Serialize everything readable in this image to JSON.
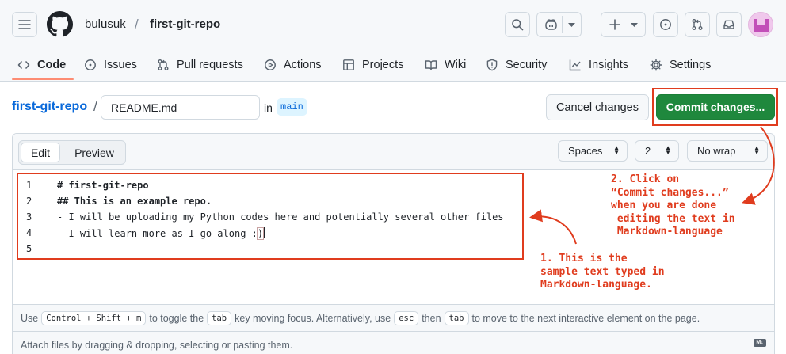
{
  "header": {
    "owner": "bulusuk",
    "separator": "/",
    "repo": "first-git-repo"
  },
  "tabs": [
    {
      "label": "Code",
      "icon": "code-icon",
      "active": true
    },
    {
      "label": "Issues",
      "icon": "issue-opened-icon"
    },
    {
      "label": "Pull requests",
      "icon": "git-pull-request-icon"
    },
    {
      "label": "Actions",
      "icon": "play-icon"
    },
    {
      "label": "Projects",
      "icon": "table-icon"
    },
    {
      "label": "Wiki",
      "icon": "book-icon"
    },
    {
      "label": "Security",
      "icon": "shield-icon"
    },
    {
      "label": "Insights",
      "icon": "graph-icon"
    },
    {
      "label": "Settings",
      "icon": "gear-icon"
    }
  ],
  "breadcrumb": {
    "repo": "first-git-repo",
    "separator": "/",
    "filename": "README.md",
    "in_word": "in",
    "branch": "main"
  },
  "actions": {
    "cancel_label": "Cancel changes",
    "commit_label": "Commit changes..."
  },
  "editor": {
    "edit_tab": "Edit",
    "preview_tab": "Preview",
    "indent_mode": "Spaces",
    "indent_size": "2",
    "wrap_mode": "No wrap",
    "lines": [
      {
        "number": "1",
        "text": "# first-git-repo"
      },
      {
        "number": "2",
        "text": "## This is an example repo."
      },
      {
        "number": "3",
        "text": "- I will be uploading my Python codes here and potentially several other files"
      },
      {
        "number": "4",
        "text": "- I will learn more as I go along :)"
      },
      {
        "number": "5",
        "text": ""
      }
    ],
    "line4_prefix": "- I will learn more as I go along :",
    "line4_paren": ")"
  },
  "hint": {
    "use": "Use",
    "key1": "Control + Shift + m",
    "t1": "to toggle the",
    "key2": "tab",
    "t2": "key moving focus. Alternatively, use",
    "key3": "esc",
    "t3": "then",
    "key4": "tab",
    "t4": "to move to the next interactive element on the page."
  },
  "attach_text": "Attach files by dragging & dropping, selecting or pasting them.",
  "markdown_badge": "M↓",
  "annotations": {
    "note2": "2. Click on\n“Commit changes...”\nwhen you are done\n editing the text in\n Markdown-language",
    "note1": "1. This is the\nsample text typed in\nMarkdown-language."
  },
  "colors": {
    "accent_link": "#0969da",
    "commit_green": "#1f883d",
    "annotation_red": "#e03c1e",
    "tab_underline": "#fd8c73"
  }
}
